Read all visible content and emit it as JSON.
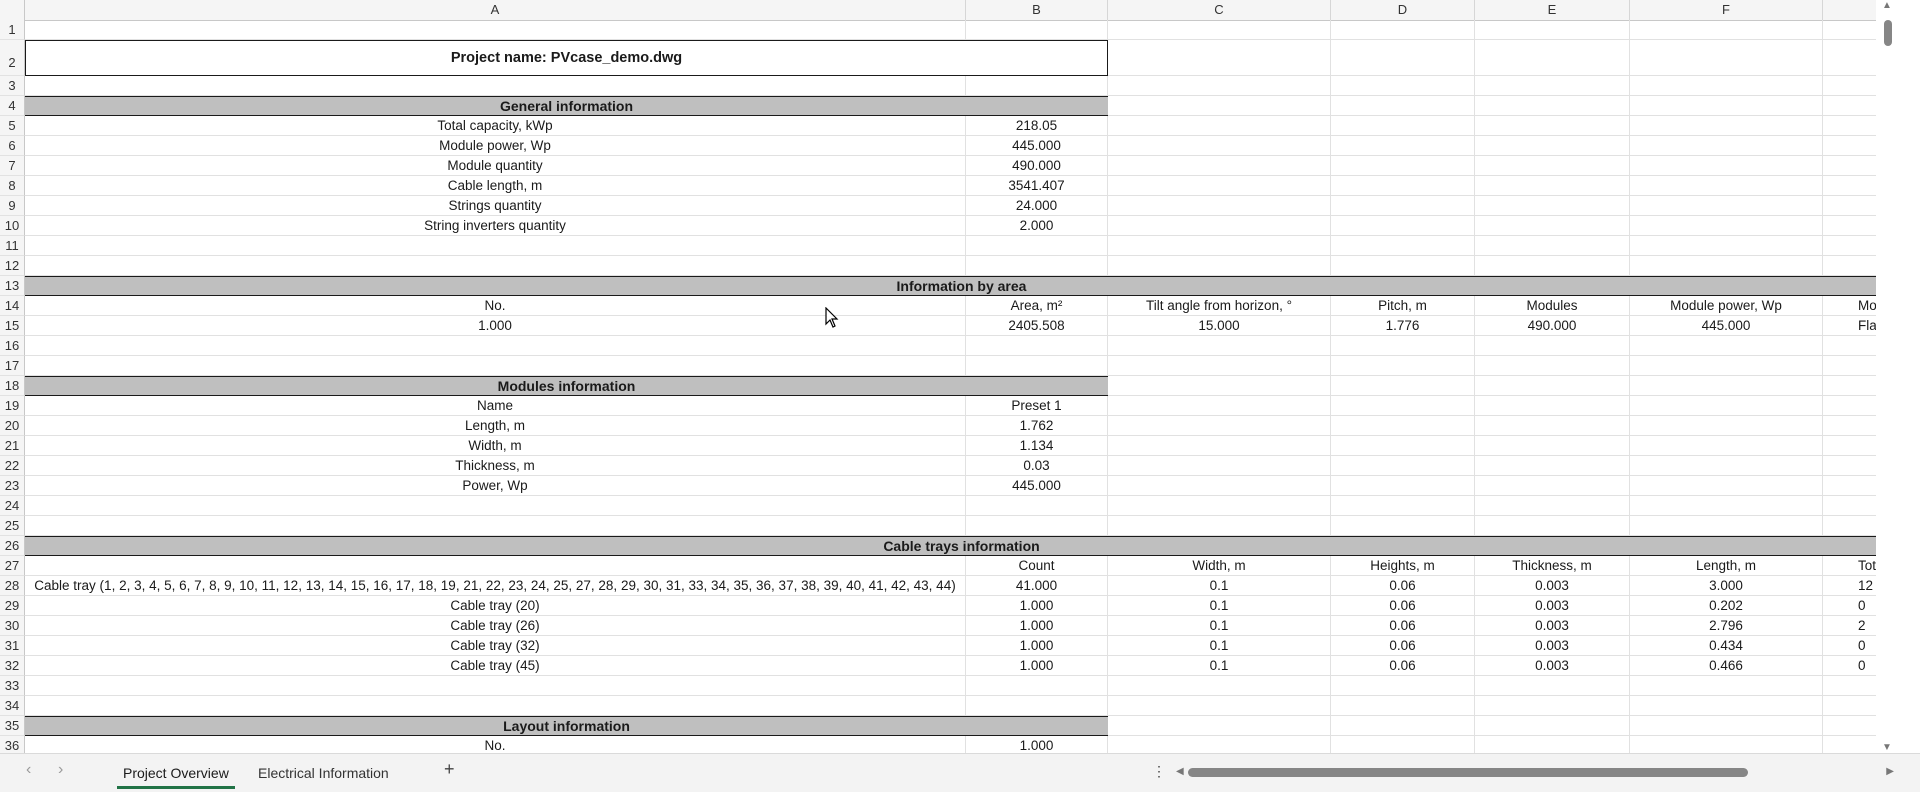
{
  "columns": [
    "A",
    "B",
    "C",
    "D",
    "E",
    "F"
  ],
  "project_title": "Project name: PVcase_demo.dwg",
  "general": {
    "heading": "General information",
    "rows": [
      {
        "label": "Total capacity, kWp",
        "value": "218.05"
      },
      {
        "label": "Module power, Wp",
        "value": "445.000"
      },
      {
        "label": "Module quantity",
        "value": "490.000"
      },
      {
        "label": "Cable length, m",
        "value": "3541.407"
      },
      {
        "label": "Strings quantity",
        "value": "24.000"
      },
      {
        "label": "String inverters quantity",
        "value": "2.000"
      }
    ]
  },
  "area": {
    "heading": "Information by area",
    "headers": [
      "No.",
      "Area, m²",
      "Tilt angle from horizon, °",
      "Pitch, m",
      "Modules",
      "Module power, Wp",
      "Mod"
    ],
    "row": [
      "1.000",
      "2405.508",
      "15.000",
      "1.776",
      "490.000",
      "445.000",
      "Flat"
    ]
  },
  "modules": {
    "heading": "Modules information",
    "rows": [
      {
        "label": "Name",
        "value": "Preset 1"
      },
      {
        "label": "Length, m",
        "value": "1.762"
      },
      {
        "label": "Width, m",
        "value": "1.134"
      },
      {
        "label": "Thickness, m",
        "value": "0.03"
      },
      {
        "label": "Power, Wp",
        "value": "445.000"
      }
    ]
  },
  "trays": {
    "heading": "Cable trays information",
    "headers": [
      "",
      "Count",
      "Width, m",
      "Heights, m",
      "Thickness, m",
      "Length, m",
      "Total l"
    ],
    "rows": [
      [
        "Cable tray (1, 2, 3, 4, 5, 6, 7, 8, 9, 10, 11, 12, 13, 14, 15, 16, 17, 18, 19, 21, 22, 23, 24, 25, 27, 28, 29, 30, 31, 33, 34, 35, 36, 37, 38, 39, 40, 41, 42, 43, 44)",
        "41.000",
        "0.1",
        "0.06",
        "0.003",
        "3.000",
        "12"
      ],
      [
        "Cable tray (20)",
        "1.000",
        "0.1",
        "0.06",
        "0.003",
        "0.202",
        "0"
      ],
      [
        "Cable tray (26)",
        "1.000",
        "0.1",
        "0.06",
        "0.003",
        "2.796",
        "2"
      ],
      [
        "Cable tray (32)",
        "1.000",
        "0.1",
        "0.06",
        "0.003",
        "0.434",
        "0"
      ],
      [
        "Cable tray (45)",
        "1.000",
        "0.1",
        "0.06",
        "0.003",
        "0.466",
        "0"
      ]
    ]
  },
  "layout": {
    "heading": "Layout information",
    "rows": [
      {
        "label": "No.",
        "value": "1.000"
      }
    ]
  },
  "tabs": [
    "Project Overview",
    "Electrical Information"
  ],
  "active_tab": "Project Overview",
  "icons": {
    "prev": "chevron-left-icon",
    "next": "chevron-right-icon",
    "add": "plus-icon",
    "more": "more-vertical-icon"
  }
}
